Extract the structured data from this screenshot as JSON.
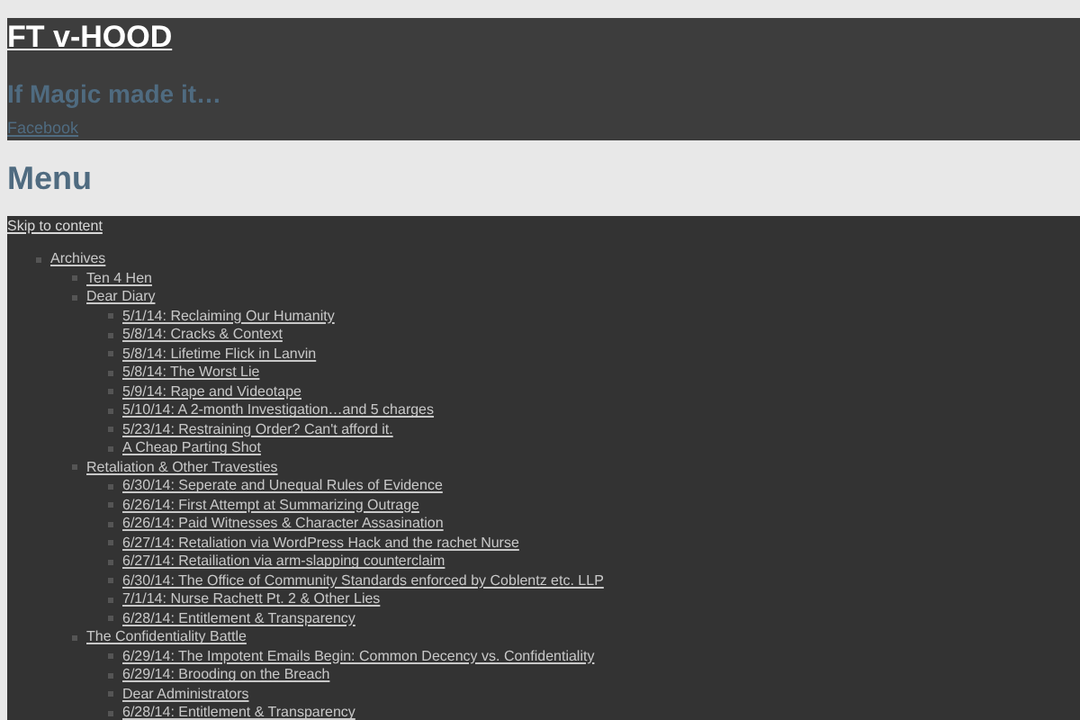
{
  "header": {
    "site_title": "FT v-HOOD",
    "tagline": "If Magic made it…",
    "social_link": "Facebook"
  },
  "menu_heading": "Menu",
  "skip_link": "Skip to content",
  "nav": [
    {
      "label": "Archives",
      "children": [
        {
          "label": "Ten 4 Hen"
        },
        {
          "label": "Dear Diary",
          "children": [
            {
              "label": "5/1/14: Reclaiming Our Humanity"
            },
            {
              "label": "5/8/14: Cracks & Context"
            },
            {
              "label": "5/8/14: Lifetime Flick in Lanvin"
            },
            {
              "label": "5/8/14: The Worst Lie"
            },
            {
              "label": "5/9/14: Rape and Videotape"
            },
            {
              "label": "5/10/14: A 2-month Investigation…and 5 charges"
            },
            {
              "label": "5/23/14: Restraining Order? Can't afford it."
            },
            {
              "label": "A Cheap Parting Shot"
            }
          ]
        },
        {
          "label": "Retaliation & Other Travesties",
          "children": [
            {
              "label": "6/30/14: Seperate and Unequal Rules of Evidence"
            },
            {
              "label": "6/26/14: First Attempt at Summarizing Outrage"
            },
            {
              "label": "6/26/14: Paid Witnesses & Character Assasination"
            },
            {
              "label": "6/27/14: Retaliation via WordPress Hack and the rachet Nurse"
            },
            {
              "label": "6/27/14: Retailiation via arm-slapping counterclaim"
            },
            {
              "label": "6/30/14: The Office of Community Standards enforced by Coblentz etc. LLP"
            },
            {
              "label": "7/1/14: Nurse Rachett Pt. 2 & Other Lies"
            },
            {
              "label": "6/28/14: Entitlement & Transparency"
            }
          ]
        },
        {
          "label": "The Confidentiality Battle",
          "children": [
            {
              "label": "6/29/14: The Impotent Emails Begin: Common Decency vs. Confidentiality"
            },
            {
              "label": "6/29/14: Brooding on the Breach"
            },
            {
              "label": "Dear Administrators"
            },
            {
              "label": "6/28/14: Entitlement & Transparency"
            }
          ]
        }
      ]
    }
  ]
}
